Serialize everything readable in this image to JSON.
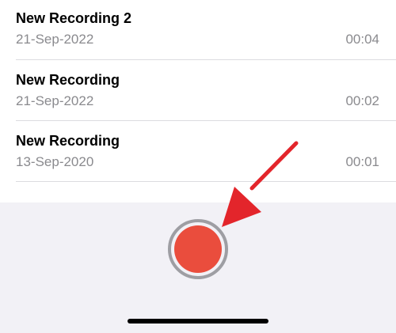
{
  "recordings": [
    {
      "title": "New Recording 2",
      "date": "21-Sep-2022",
      "duration": "00:04"
    },
    {
      "title": "New Recording",
      "date": "21-Sep-2022",
      "duration": "00:02"
    },
    {
      "title": "New Recording",
      "date": "13-Sep-2020",
      "duration": "00:01"
    }
  ],
  "record_button": {
    "icon": "record-icon",
    "color": "#ea4d3d"
  },
  "annotation": {
    "icon": "arrow-icon",
    "color": "#e3252b"
  },
  "colors": {
    "panel": "#f2f1f6",
    "secondary_text": "#8a8a8e",
    "divider": "#dcdce0"
  }
}
